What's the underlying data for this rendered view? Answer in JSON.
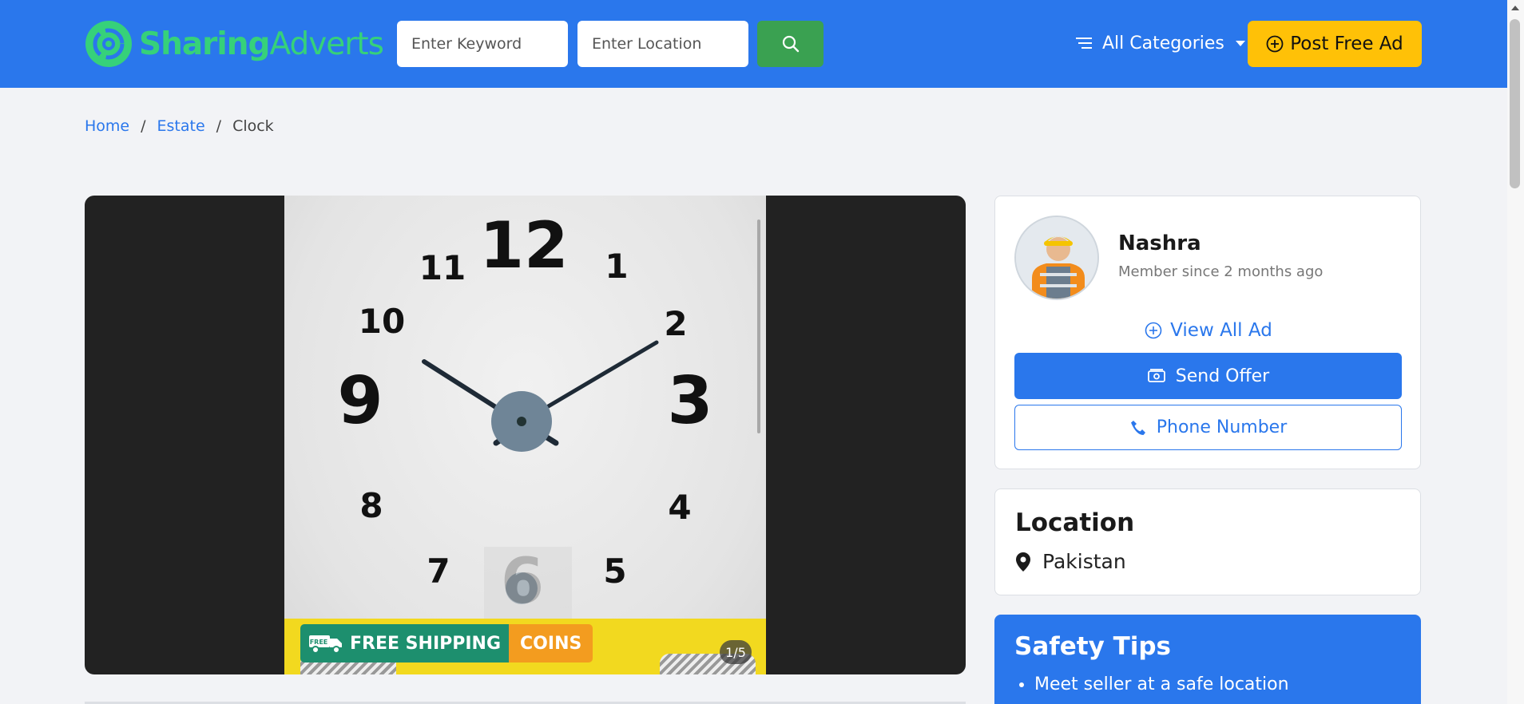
{
  "header": {
    "logo_bold": "Sharing",
    "logo_light": "Adverts",
    "keyword_placeholder": "Enter Keyword",
    "location_placeholder": "Enter Location",
    "categories_label": "All Categories",
    "post_ad_label": "Post Free Ad"
  },
  "breadcrumb": {
    "items": [
      "Home",
      "Estate",
      "Clock"
    ],
    "separator": "/"
  },
  "gallery": {
    "banner_primary": "FREE SHIPPING",
    "banner_secondary": "COINS",
    "banner_truck_text": "FREE",
    "counter": "1/5",
    "clock_numbers": [
      "12",
      "1",
      "2",
      "3",
      "4",
      "5",
      "6",
      "7",
      "8",
      "9",
      "10",
      "11"
    ]
  },
  "seller": {
    "name": "Nashra",
    "member_since": "Member since 2 months ago",
    "view_all_label": "View All Ad",
    "send_offer_label": "Send Offer",
    "phone_label": "Phone Number"
  },
  "location": {
    "title": "Location",
    "value": "Pakistan"
  },
  "safety": {
    "title": "Safety Tips",
    "tips": [
      "Meet seller at a safe location"
    ]
  },
  "colors": {
    "primary": "#2a77ec",
    "logo_green": "#36d17a",
    "search_green": "#3aa151",
    "post_yellow": "#ffc107"
  }
}
